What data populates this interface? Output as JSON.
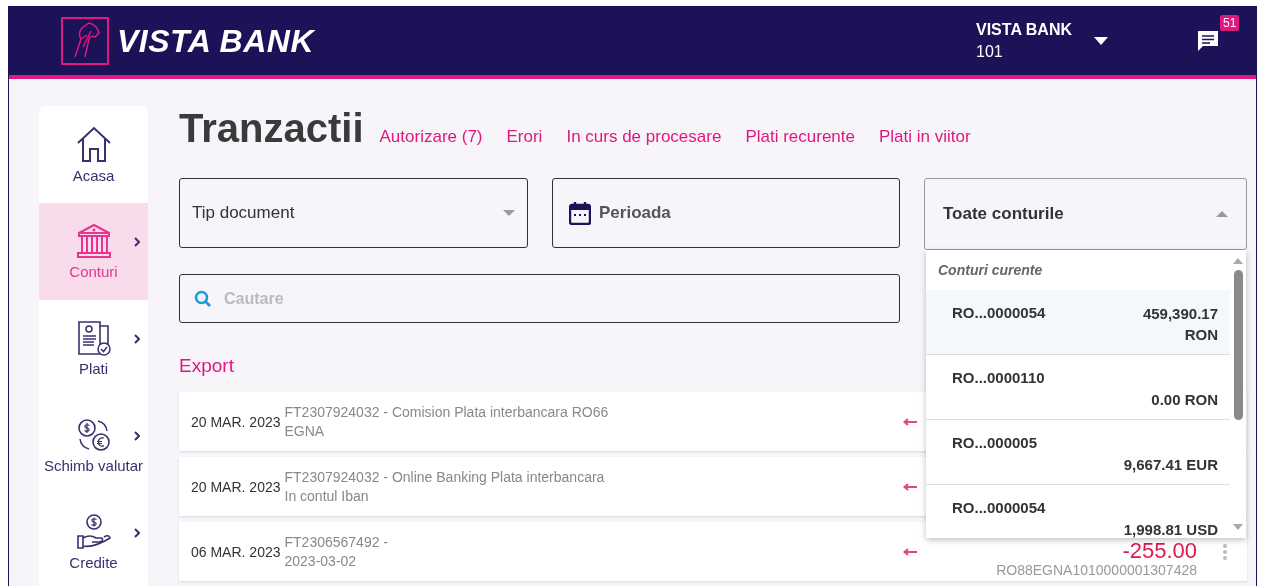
{
  "header": {
    "brand": "VISTA BANK",
    "user_name": "VISTA BANK",
    "user_code": "101",
    "notifications": "51"
  },
  "sidebar": {
    "items": [
      {
        "label": "Acasa",
        "kind": "home",
        "selected": false,
        "has_submenu": false
      },
      {
        "label": "Conturi",
        "kind": "bank",
        "selected": true,
        "has_submenu": true
      },
      {
        "label": "Plati",
        "kind": "payment",
        "selected": false,
        "has_submenu": true
      },
      {
        "label": "Schimb valutar",
        "kind": "exchange",
        "selected": false,
        "has_submenu": true
      },
      {
        "label": "Credite",
        "kind": "credit",
        "selected": false,
        "has_submenu": true
      }
    ]
  },
  "page": {
    "title": "Tranzactii",
    "tabs": [
      {
        "label": "Autorizare (7)",
        "selected": false
      },
      {
        "label": "Erori",
        "selected": false
      },
      {
        "label": "In curs de procesare",
        "selected": false
      },
      {
        "label": "Plati recurente",
        "selected": false
      },
      {
        "label": "Plati in viitor",
        "selected": false
      }
    ]
  },
  "filters": {
    "document_type": {
      "placeholder": "Tip document"
    },
    "period": {
      "placeholder": "Perioada"
    },
    "accounts": {
      "value": "Toate conturile",
      "expanded": true,
      "group": "Conturi curente",
      "options": [
        {
          "account": "RO...0000054",
          "balance": "459,390.17 RON",
          "selected": true
        },
        {
          "account": "RO...0000110",
          "balance": "0.00 RON",
          "selected": false
        },
        {
          "account": "RO...000005",
          "balance": "9,667.41 EUR",
          "selected": false
        },
        {
          "account": "RO...0000054",
          "balance": "1,998.81 USD",
          "selected": false
        }
      ]
    }
  },
  "search": {
    "placeholder": "Cautare"
  },
  "export": "Export",
  "transactions": [
    {
      "date": "20 MAR. 2023",
      "description_lines": [
        "FT2307924032 - Comision Plata interbancara RO66",
        "EGNA"
      ],
      "kind": "outgoing"
    },
    {
      "date": "20 MAR. 2023",
      "description_lines": [
        "FT2307924032 - Online Banking Plata interbancara",
        "In contul Iban"
      ],
      "kind": "outgoing"
    },
    {
      "date": "06 MAR. 2023",
      "description_lines": [
        "FT2306567492 -",
        "2023-03-02"
      ],
      "kind": "outgoing",
      "amount": "-255.00",
      "account": "RO88EGNA1010000001307428"
    }
  ]
}
